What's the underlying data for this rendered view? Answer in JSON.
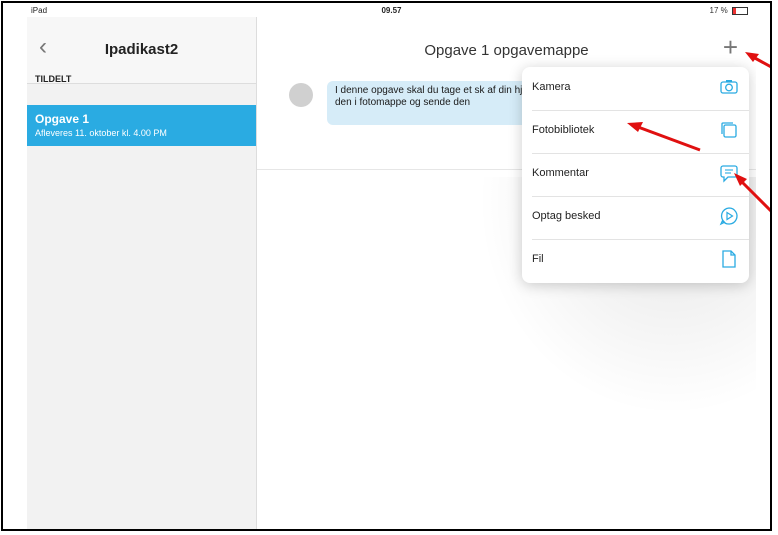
{
  "status": {
    "device": "iPad",
    "time": "09.57",
    "battery": "17 %"
  },
  "sidebar": {
    "back_icon": "chevron-left-icon",
    "title": "Ipadikast2",
    "section": "TILDELT",
    "items": [
      {
        "name": "Opgave 1",
        "due": "Afleveres 11. oktober kl. 4.00 PM",
        "selected": true
      }
    ]
  },
  "main": {
    "title": "Opgave 1 opgavemappe",
    "add_icon": "plus-icon",
    "message": "I denne opgave skal du tage et sk af din hjemmeskærm, finde den i fotomappe og sende den"
  },
  "popover": {
    "items": [
      {
        "label": "Kamera",
        "icon": "camera-icon"
      },
      {
        "label": "Fotobibliotek",
        "icon": "photo-library-icon"
      },
      {
        "label": "Kommentar",
        "icon": "comment-icon"
      },
      {
        "label": "Optag besked",
        "icon": "record-message-icon"
      },
      {
        "label": "Fil",
        "icon": "file-icon"
      }
    ]
  },
  "colors": {
    "accent": "#2aabe2",
    "arrow": "#e01010",
    "bubble": "#d6ecf8"
  }
}
